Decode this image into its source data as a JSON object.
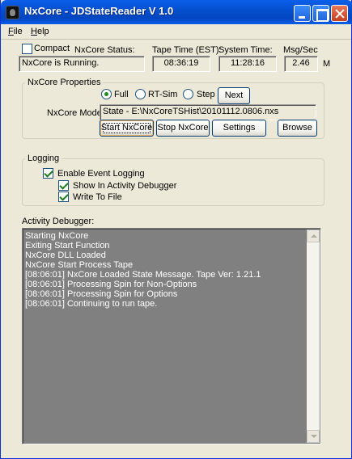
{
  "window": {
    "title": "NxCore - JDStateReader V 1.0"
  },
  "menu": [
    {
      "label": "File",
      "key": "F",
      "rest": "ile"
    },
    {
      "label": "Help",
      "key": "H",
      "rest": "elp"
    }
  ],
  "status_row": {
    "compact_label": "Compact",
    "compact_checked": false,
    "nxcore_status_label": "NxCore Status:",
    "nxcore_status_value": "NxCore is Running.",
    "tape_time_label": "Tape Time (EST):",
    "tape_time_value": "08:36:19",
    "system_time_label": "System Time:",
    "system_time_value": "11:28:16",
    "msg_sec_label": "Msg/Sec",
    "msg_sec_value": "2.46",
    "msg_sec_unit": "M"
  },
  "properties": {
    "title": "NxCore Properties",
    "modes": [
      {
        "label": "Full",
        "checked": true
      },
      {
        "label": "RT-Sim",
        "checked": false
      },
      {
        "label": "Step",
        "checked": false
      }
    ],
    "next_label": "Next",
    "mode_label": "NxCore Mode:",
    "mode_value": "State - E:\\NxCoreTSHist\\20101112.0806.nxs",
    "buttons": {
      "start": "Start NxCore",
      "stop": "Stop NxCore",
      "settings": "Settings",
      "browse": "Browse"
    }
  },
  "logging": {
    "title": "Logging",
    "enable_label": "Enable Event Logging",
    "enable_checked": true,
    "show_debugger_label": "Show In Activity Debugger",
    "show_debugger_checked": true,
    "write_file_label": "Write To File",
    "write_file_checked": true
  },
  "debugger": {
    "title": "Activity Debugger:",
    "lines": [
      "Starting NxCore",
      "Exiting Start Function",
      "NxCore DLL Loaded",
      "NxCore Start Process Tape",
      "[08:06:01] NxCore Loaded State Message. Tape Ver: 1.21.1",
      "[08:06:01] Processing Spin for Non-Options",
      "[08:06:01] Processing Spin for Options",
      "[08:06:01] Continuing to run tape."
    ]
  },
  "colors": {
    "title_bar": "#0550d0",
    "window_bg": "#ece9d8",
    "debugger_bg": "#808080"
  },
  "icons": [
    "app-icon",
    "minimize-icon",
    "maximize-icon",
    "close-icon",
    "scroll-up-icon",
    "scroll-down-icon"
  ]
}
